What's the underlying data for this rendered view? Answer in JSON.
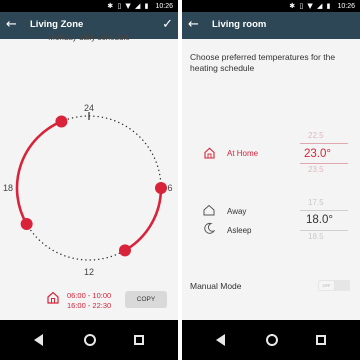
{
  "status": {
    "time": "10:26",
    "icons": [
      "bluetooth-icon",
      "vibrate-icon",
      "wifi-icon",
      "signal-icon",
      "battery-icon"
    ]
  },
  "left_screen": {
    "appbar": {
      "title": "Living Zone",
      "back_icon": "arrow-left-icon",
      "confirm_icon": "check-icon"
    },
    "schedule_title": "Monday daily schedule",
    "dial": {
      "hour_labels": {
        "top": "24",
        "right": "6",
        "bottom": "12",
        "left": "18"
      },
      "accent": "#d8233a",
      "periods": [
        {
          "from": "06:00",
          "to": "10:00"
        },
        {
          "from": "16:00",
          "to": "22:30"
        }
      ]
    },
    "schedule_times": {
      "line1": "06:00 - 10:00",
      "line2": "16:00 - 22:30"
    },
    "copy_label": "COPY"
  },
  "right_screen": {
    "appbar": {
      "title": "Living room",
      "back_icon": "arrow-left-icon"
    },
    "prompt": "Choose preferred temperatures for the heating schedule",
    "at_home": {
      "label": "At Home",
      "value": "23.0°",
      "above": "22.5",
      "below": "23.5",
      "color": "#d8233a"
    },
    "away": {
      "label": "Away",
      "value": "18.0°",
      "above": "17.5",
      "below": "18.5"
    },
    "asleep": {
      "label": "Asleep"
    },
    "manual_mode": {
      "label": "Manual Mode",
      "toggle_text": "OFF",
      "on": false
    }
  },
  "navbar": {
    "icons": [
      "nav-back-icon",
      "nav-home-icon",
      "nav-recents-icon"
    ]
  }
}
